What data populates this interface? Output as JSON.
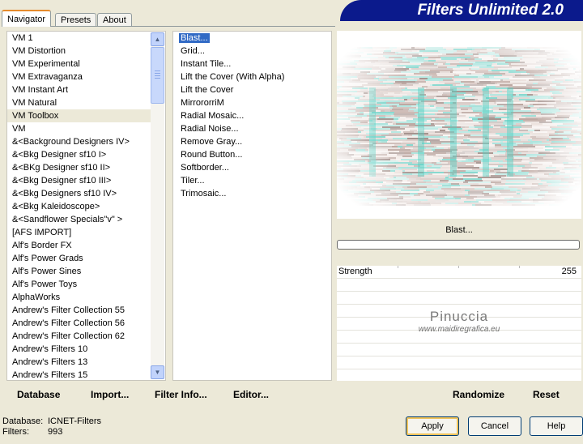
{
  "tabs": [
    {
      "label": "Navigator",
      "active": true
    },
    {
      "label": "Presets",
      "active": false
    },
    {
      "label": "About",
      "active": false
    }
  ],
  "banner": {
    "title": "Filters Unlimited 2.0",
    "color": "#0b1a8c"
  },
  "categories": [
    "VM 1",
    "VM Distortion",
    "VM Experimental",
    "VM Extravaganza",
    "VM Instant Art",
    "VM Natural",
    "VM Toolbox",
    "VM",
    "&<Background Designers IV>",
    "&<Bkg Designer sf10 I>",
    "&<BKg Designer sf10 II>",
    "&<Bkg Designer sf10 III>",
    "&<Bkg Designers sf10 IV>",
    "&<Bkg Kaleidoscope>",
    "&<Sandflower Specials\"v\" >",
    "[AFS IMPORT]",
    "Alf's Border FX",
    "Alf's Power Grads",
    "Alf's Power Sines",
    "Alf's Power Toys",
    "AlphaWorks",
    "Andrew's Filter Collection 55",
    "Andrew's Filter Collection 56",
    "Andrew's Filter Collection 62",
    "Andrew's Filters 10",
    "Andrew's Filters 13",
    "Andrew's Filters 15"
  ],
  "selected_category": "VM Toolbox",
  "filters": [
    "Blast...",
    "Grid...",
    "Instant Tile...",
    "Lift the Cover (With Alpha)",
    "Lift the Cover",
    "MirrororriM",
    "Radial Mosaic...",
    "Radial Noise...",
    "Remove Gray...",
    "Round Button...",
    "Softborder...",
    "Tiler...",
    "Trimosaic..."
  ],
  "selected_filter": "Blast...",
  "preview": {
    "filter_name": "Blast...",
    "progress": 0
  },
  "params": [
    {
      "label": "Strength",
      "value": "255"
    }
  ],
  "watermark": {
    "name": "Pinuccia",
    "site": "www.maidiregrafica.eu"
  },
  "left_buttons": [
    "Database",
    "Import...",
    "Filter Info...",
    "Editor..."
  ],
  "right_buttons": [
    "Randomize",
    "Reset"
  ],
  "footer": {
    "database_label": "Database:",
    "database_value": "ICNET-Filters",
    "filters_label": "Filters:",
    "filters_value": "993"
  },
  "dialog_buttons": {
    "apply": "Apply",
    "cancel": "Cancel",
    "help": "Help"
  },
  "colors": {
    "selection": "#316ac5",
    "dialog_bg": "#ece9d8"
  }
}
